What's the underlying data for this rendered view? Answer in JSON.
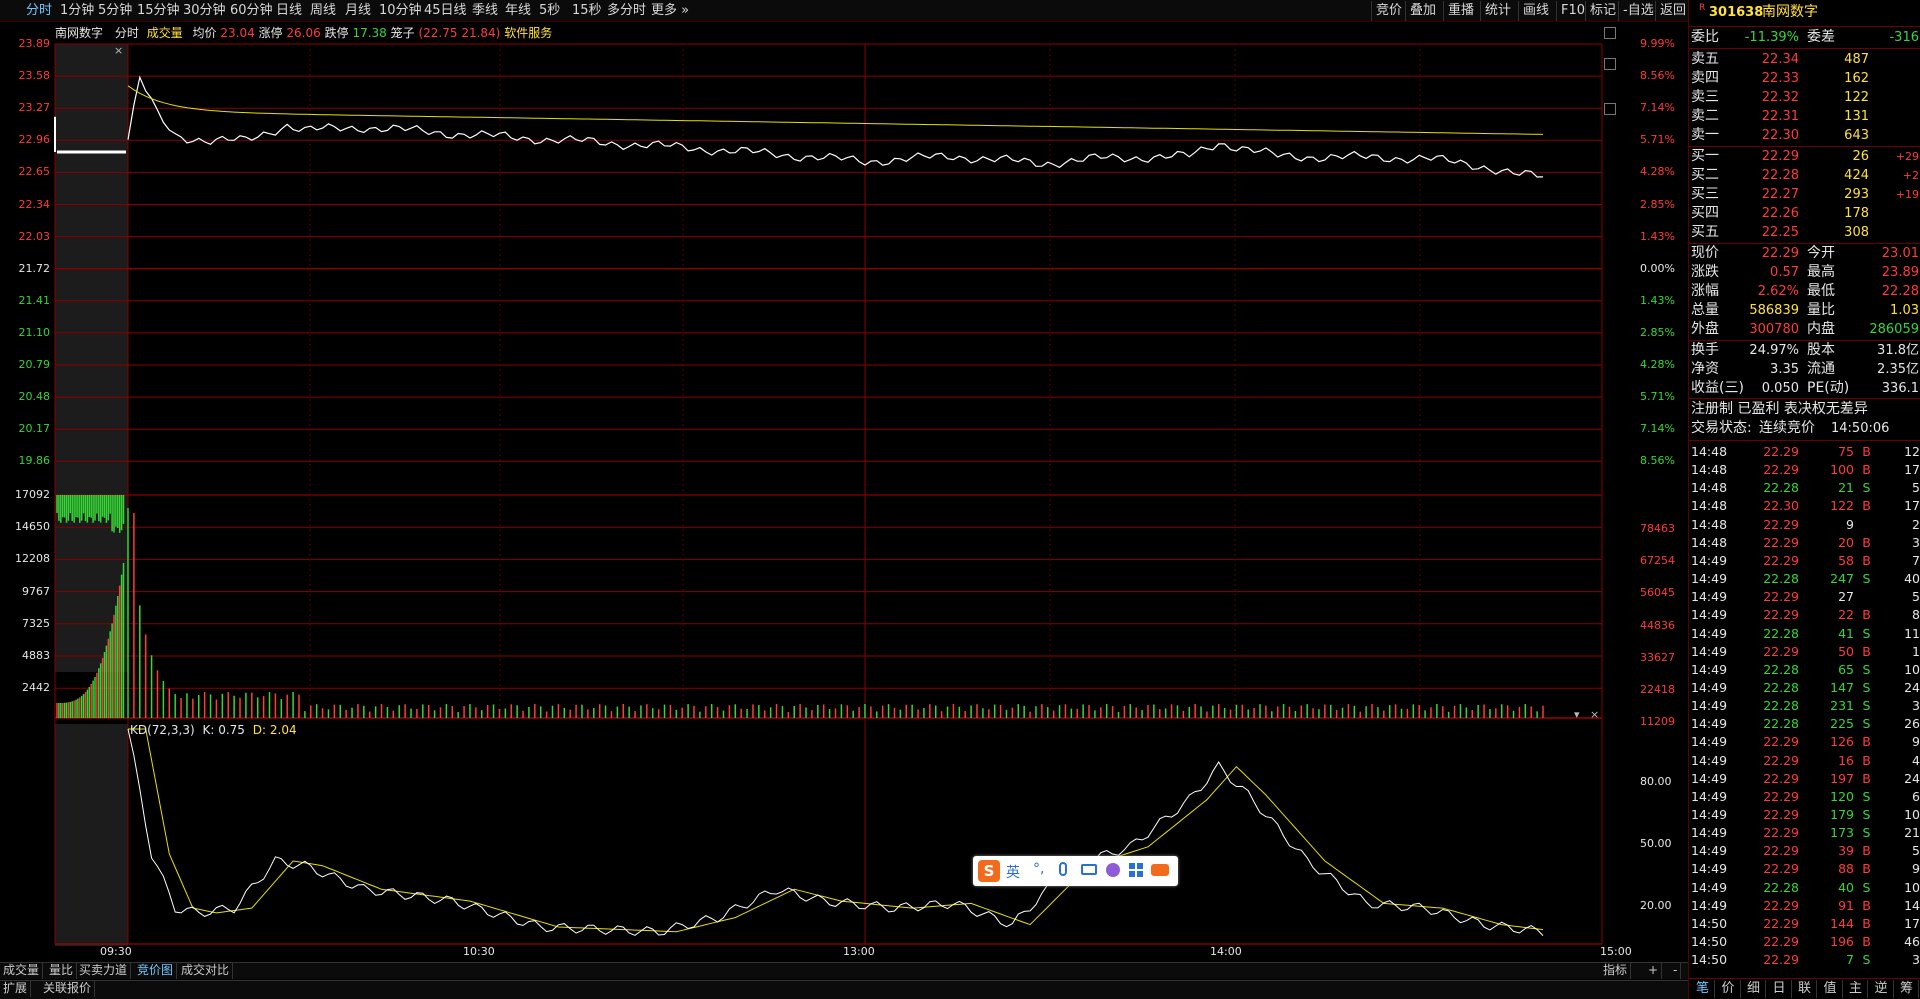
{
  "toolbar": {
    "periods": [
      "分时",
      "1分钟",
      "5分钟",
      "15分钟",
      "30分钟",
      "60分钟",
      "日线",
      "周线",
      "月线",
      "10分钟",
      "45日线",
      "季线",
      "年线",
      "5秒",
      "15秒",
      "多分时",
      "更多"
    ],
    "active": "分时",
    "right_buttons": [
      "竞价",
      "叠加",
      "重播",
      "统计",
      "画线",
      "F10",
      "标记",
      "-自选",
      "返回"
    ]
  },
  "chart": {
    "stock_name": "南网数字",
    "mode": "分时",
    "volume_label": "成交量",
    "avg_label": "均价",
    "avg_value": "23.04",
    "limit_up_label": "涨停",
    "limit_up_value": "26.06",
    "limit_down_label": "跌停",
    "limit_down_value": "17.38",
    "cage_label": "笼子",
    "cage_value": "(22.75 21.84)",
    "sector": "软件服务",
    "price_axis": [
      "23.89",
      "23.58",
      "23.27",
      "22.96",
      "22.65",
      "22.34",
      "22.03",
      "21.72",
      "21.41",
      "21.10",
      "20.79",
      "20.48",
      "20.17",
      "19.86"
    ],
    "pct_axis": [
      "9.99%",
      "8.56%",
      "7.14%",
      "5.71%",
      "4.28%",
      "2.85%",
      "1.43%",
      "0.00%",
      "1.43%",
      "2.85%",
      "4.28%",
      "5.71%",
      "7.14%",
      "8.56%"
    ],
    "vol_axis_left": [
      "17092",
      "14650",
      "12208",
      "9767",
      "7325",
      "4883",
      "2442"
    ],
    "vol_axis_right": [
      "78463",
      "67254",
      "56045",
      "44836",
      "33627",
      "22418",
      "11209"
    ],
    "kd_label": "KD(72,3,3)",
    "k_label": "K:",
    "k_value": "0.75",
    "d_label": "D:",
    "d_value": "2.04",
    "kd_axis": [
      "80.00",
      "50.00",
      "20.00"
    ],
    "time_axis": [
      "09:30",
      "10:30",
      "13:00",
      "14:00",
      "15:00"
    ],
    "close_glyph": "×",
    "dropdown_glyph": "▾",
    "ime_text": "英"
  },
  "bottom_tabs": {
    "row1": [
      "成交量",
      "量比",
      "买卖力道",
      "竞价图",
      "成交对比"
    ],
    "row1_active": "竞价图",
    "row1_right": [
      "指标",
      "+",
      "-"
    ],
    "row2": [
      "扩展",
      "关联报价"
    ]
  },
  "panel": {
    "code_flag": "R",
    "code": "301638",
    "name": "南网数字",
    "wb_label": "委比",
    "wb_value": "-11.39%",
    "wc_label": "委差",
    "wc_value": "-316",
    "sells": [
      {
        "label": "卖五",
        "price": "22.34",
        "vol": "487"
      },
      {
        "label": "卖四",
        "price": "22.33",
        "vol": "162"
      },
      {
        "label": "卖三",
        "price": "22.32",
        "vol": "122"
      },
      {
        "label": "卖二",
        "price": "22.31",
        "vol": "131"
      },
      {
        "label": "卖一",
        "price": "22.30",
        "vol": "643"
      }
    ],
    "buys": [
      {
        "label": "买一",
        "price": "22.29",
        "vol": "26",
        "chg": "+29"
      },
      {
        "label": "买二",
        "price": "22.28",
        "vol": "424",
        "chg": "+2"
      },
      {
        "label": "买三",
        "price": "22.27",
        "vol": "293",
        "chg": "+19"
      },
      {
        "label": "买四",
        "price": "22.26",
        "vol": "178",
        "chg": ""
      },
      {
        "label": "买五",
        "price": "22.25",
        "vol": "308",
        "chg": ""
      }
    ],
    "stats": [
      {
        "l1": "现价",
        "v1": "22.29",
        "l2": "今开",
        "v2": "23.01",
        "c1": "red",
        "c2": "red"
      },
      {
        "l1": "涨跌",
        "v1": "0.57",
        "l2": "最高",
        "v2": "23.89",
        "c1": "red",
        "c2": "red"
      },
      {
        "l1": "涨幅",
        "v1": "2.62%",
        "l2": "最低",
        "v2": "22.28",
        "c1": "red",
        "c2": "red"
      },
      {
        "l1": "总量",
        "v1": "586839",
        "l2": "量比",
        "v2": "1.03",
        "c1": "yel",
        "c2": "yel"
      },
      {
        "l1": "外盘",
        "v1": "300780",
        "l2": "内盘",
        "v2": "286059",
        "c1": "red",
        "c2": "grn"
      }
    ],
    "stats2": [
      {
        "l1": "换手",
        "v1": "24.97%",
        "l2": "股本",
        "v2": "31.8亿"
      },
      {
        "l1": "净资",
        "v1": "3.35",
        "l2": "流通",
        "v2": "2.35亿"
      },
      {
        "l1": "收益(三)",
        "v1": "0.050",
        "l2": "PE(动)",
        "v2": "336.1"
      }
    ],
    "tags": "注册制 已盈利 表决权无差异",
    "status_label": "交易状态:",
    "status_value": "连续竞价",
    "status_time": "14:50:06",
    "trades": [
      [
        "14:48",
        "22.29",
        "75",
        "B",
        "12"
      ],
      [
        "14:48",
        "22.29",
        "100",
        "B",
        "17"
      ],
      [
        "14:48",
        "22.28",
        "21",
        "S",
        "5"
      ],
      [
        "14:48",
        "22.30",
        "122",
        "B",
        "17"
      ],
      [
        "14:48",
        "22.29",
        "9",
        "",
        "2"
      ],
      [
        "14:48",
        "22.29",
        "20",
        "B",
        "3"
      ],
      [
        "14:49",
        "22.29",
        "58",
        "B",
        "7"
      ],
      [
        "14:49",
        "22.28",
        "247",
        "S",
        "40"
      ],
      [
        "14:49",
        "22.29",
        "27",
        "",
        "5"
      ],
      [
        "14:49",
        "22.29",
        "22",
        "B",
        "8"
      ],
      [
        "14:49",
        "22.28",
        "41",
        "S",
        "11"
      ],
      [
        "14:49",
        "22.29",
        "50",
        "B",
        "1"
      ],
      [
        "14:49",
        "22.28",
        "65",
        "S",
        "10"
      ],
      [
        "14:49",
        "22.28",
        "147",
        "S",
        "24"
      ],
      [
        "14:49",
        "22.28",
        "231",
        "S",
        "3"
      ],
      [
        "14:49",
        "22.28",
        "225",
        "S",
        "26"
      ],
      [
        "14:49",
        "22.29",
        "126",
        "B",
        "9"
      ],
      [
        "14:49",
        "22.29",
        "16",
        "B",
        "4"
      ],
      [
        "14:49",
        "22.29",
        "197",
        "B",
        "24"
      ],
      [
        "14:49",
        "22.29",
        "120",
        "S",
        "6"
      ],
      [
        "14:49",
        "22.29",
        "179",
        "S",
        "10"
      ],
      [
        "14:49",
        "22.29",
        "173",
        "S",
        "21"
      ],
      [
        "14:49",
        "22.29",
        "39",
        "B",
        "5"
      ],
      [
        "14:49",
        "22.29",
        "88",
        "B",
        "9"
      ],
      [
        "14:49",
        "22.28",
        "40",
        "S",
        "10"
      ],
      [
        "14:49",
        "22.29",
        "91",
        "B",
        "14"
      ],
      [
        "14:50",
        "22.29",
        "144",
        "B",
        "17"
      ],
      [
        "14:50",
        "22.29",
        "196",
        "B",
        "46"
      ],
      [
        "14:50",
        "22.29",
        "7",
        "S",
        "3"
      ]
    ],
    "bottom_tabs": [
      "笔",
      "价",
      "细",
      "日",
      "联",
      "值",
      "主",
      "逆",
      "筹"
    ]
  },
  "colors": {
    "up": "#ff3b3b",
    "down": "#36d636",
    "grid": "#8a0000",
    "price_line": "#ffffff",
    "avg_line": "#e8e000"
  }
}
